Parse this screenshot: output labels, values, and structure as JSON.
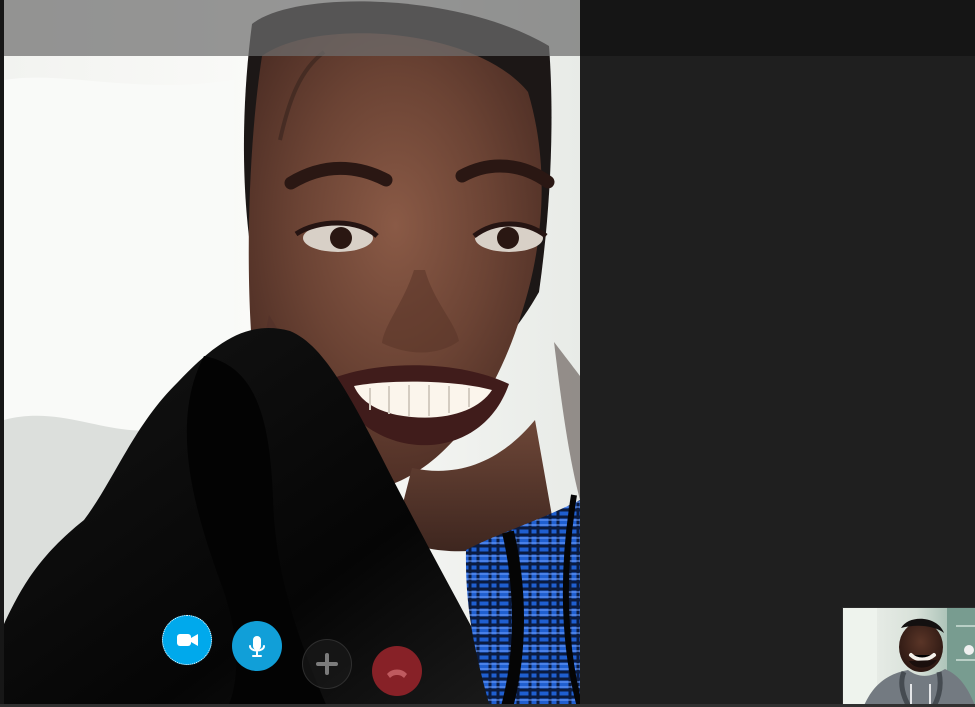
{
  "call": {
    "state": "video call",
    "remote_participant_visible": true,
    "self_preview_visible": true
  },
  "controls": {
    "video": {
      "icon": "video-camera-icon",
      "color": "#00a9ec",
      "focused": true
    },
    "microphone": {
      "icon": "microphone-icon",
      "color": "#119fd8"
    },
    "add": {
      "icon": "plus-icon",
      "color": "#1a1a1a"
    },
    "end_call": {
      "icon": "phone-hangup-icon",
      "color": "#872127"
    }
  },
  "colors": {
    "window_background": "#1f1f1f",
    "top_bar": "#151515",
    "remote_video_overlay": "#6e6e6e"
  }
}
